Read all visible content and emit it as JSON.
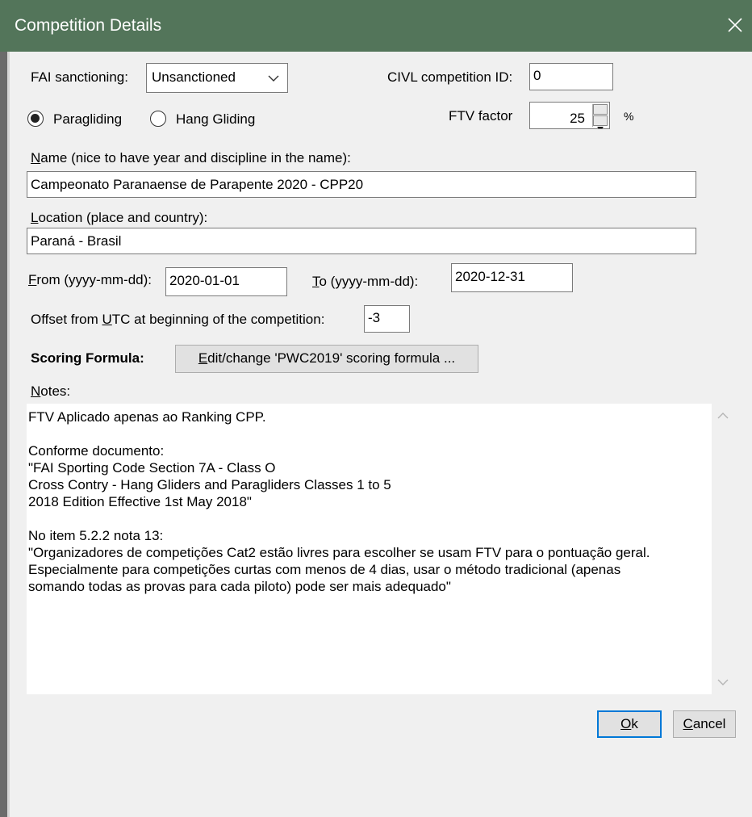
{
  "window": {
    "title": "Competition Details",
    "close_symbol": "✕",
    "title_color": "#53755a"
  },
  "fai": {
    "label": "FAI sanctioning:",
    "selected": "Unsanctioned"
  },
  "civl": {
    "label": "CIVL competition ID:",
    "value": "0"
  },
  "discipline": {
    "options": [
      {
        "label": "Paragliding",
        "checked": true
      },
      {
        "label": "Hang Gliding",
        "checked": false
      }
    ]
  },
  "ftv": {
    "label": "FTV factor",
    "value": "25",
    "unit": "%"
  },
  "name": {
    "label_mn": "N",
    "label_rest": "ame (nice to have year and discipline in the name):",
    "value": "Campeonato Paranaense de Parapente 2020 - CPP20"
  },
  "location": {
    "label_mn": "L",
    "label_rest": "ocation (place and country):",
    "value": "Paraná - Brasil"
  },
  "dates": {
    "from_mn": "F",
    "from_rest": "rom (yyyy-mm-dd):",
    "from_value": "2020-01-01",
    "to_mn": "T",
    "to_rest": "o (yyyy-mm-dd):",
    "to_value": "2020-12-31"
  },
  "utc": {
    "label_pre": "Offset from ",
    "label_mn": "U",
    "label_post": "TC at beginning of the competition:",
    "value": "-3"
  },
  "scoring": {
    "label": "Scoring Formula:",
    "button_mn": "E",
    "button_rest": "dit/change 'PWC2019' scoring formula ..."
  },
  "notes": {
    "label_mn": "N",
    "label_rest": "otes:",
    "text": "FTV Aplicado apenas ao Ranking CPP.\n\nConforme documento:\n\"FAI Sporting Code Section 7A - Class O\nCross Contry - Hang Gliders and Paragliders Classes 1 to 5\n2018 Edition Effective 1st May 2018\"\n\nNo item 5.2.2 nota 13:\n\"Organizadores de competições Cat2 estão livres para escolher se usam FTV para o pontuação geral.\nEspecialmente para competições curtas com menos de 4 dias, usar o método tradicional (apenas\nsomando todas as provas para cada piloto) pode ser mais adequado\""
  },
  "buttons": {
    "ok_mn": "O",
    "ok_rest": "k",
    "cancel_mn": "C",
    "cancel_rest": "ancel"
  }
}
